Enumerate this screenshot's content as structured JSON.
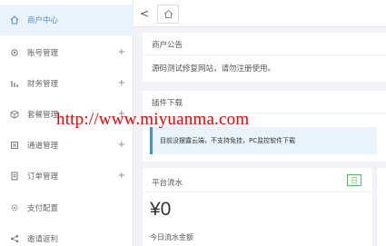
{
  "sidebar": {
    "items": [
      {
        "label": "商户中心",
        "icon": "home-icon",
        "active": true,
        "expandable": false
      },
      {
        "label": "账号管理",
        "icon": "gear-icon",
        "active": false,
        "expandable": true,
        "toggle": "+"
      },
      {
        "label": "财务管理",
        "icon": "chart-bar-icon",
        "active": false,
        "expandable": true,
        "toggle": "+"
      },
      {
        "label": "套餐管理",
        "icon": "package-icon",
        "active": false,
        "expandable": true,
        "toggle": "+"
      },
      {
        "label": "通道管理",
        "icon": "channel-icon",
        "active": false,
        "expandable": true,
        "toggle": "+"
      },
      {
        "label": "订单管理",
        "icon": "order-icon",
        "active": false,
        "expandable": true,
        "toggle": "+"
      },
      {
        "label": "支付配置",
        "icon": "settings-icon",
        "active": false,
        "expandable": false
      },
      {
        "label": "邀请返利",
        "icon": "share-icon",
        "active": false,
        "expandable": false
      }
    ]
  },
  "topbar": {
    "collapse_glyph": "<",
    "home_tab_icon": "home-icon"
  },
  "announcement": {
    "title": "商户公告",
    "text": "源码测试修复网站，请勿注册使用。"
  },
  "plugin": {
    "title": "插件下载",
    "notice": "目前没摆露云端，不支持免挂，PC监控软件下载"
  },
  "platform_flow": {
    "title": "平台流水",
    "badge": "日",
    "amount": "¥0",
    "amount_label": "今日流水金额"
  },
  "watermark": "http://www.miyuanma.com",
  "colors": {
    "accent": "#4a90c8",
    "badge_green": "#5cb85c",
    "watermark_red": "#ee0000",
    "alert_bg": "#eaf3fb"
  }
}
